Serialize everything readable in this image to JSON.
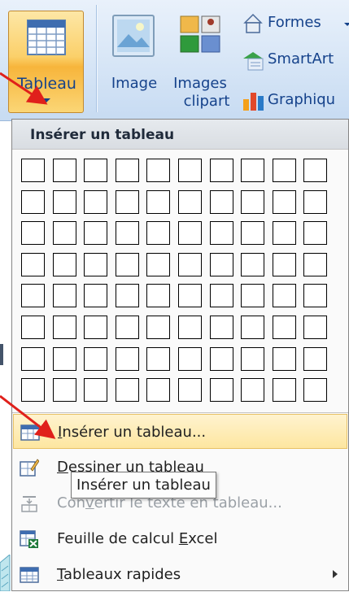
{
  "ribbon": {
    "tableau_label": "Tableau",
    "image_label": "Image",
    "images_label_line1": "Images",
    "images_label_line2": "clipart",
    "formes_label": "Formes",
    "smartart_label": "SmartArt",
    "graphique_label": "Graphiqu"
  },
  "menu": {
    "header": "Insérer un tableau",
    "grid": {
      "rows": 8,
      "cols": 10
    },
    "items": [
      {
        "label_pre": "",
        "label_u": "I",
        "label_post": "nsérer un tableau...",
        "icon": "insert-table-icon",
        "highlighted": true
      },
      {
        "label_pre": "",
        "label_u": "D",
        "label_post": "essiner un tableau",
        "icon": "draw-table-icon"
      },
      {
        "label_pre": "Con",
        "label_u": "v",
        "label_post": "ertir le texte en tableau...",
        "icon": "convert-text-icon",
        "disabled": true
      },
      {
        "label_pre": "Feuille de calcul ",
        "label_u": "E",
        "label_post": "xcel",
        "icon": "excel-sheet-icon"
      },
      {
        "label_pre": "",
        "label_u": "T",
        "label_post": "ableaux rapides",
        "icon": "quick-tables-icon",
        "submenu": true
      }
    ]
  },
  "tooltip": {
    "text": "Insérer un tableau"
  },
  "colors": {
    "accent": "#15428b",
    "highlight": "#fde6a0",
    "annotation": "#e0201b"
  }
}
